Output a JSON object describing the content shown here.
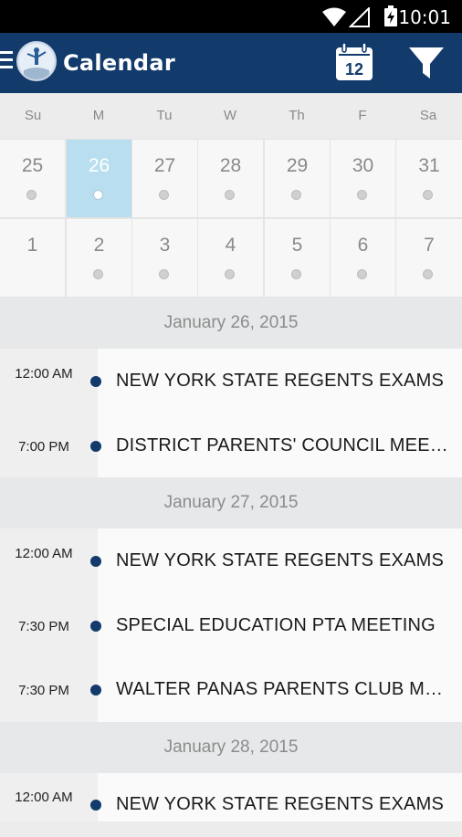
{
  "status_bar": {
    "time": "10:01",
    "battery_level": 0.6
  },
  "app_bar": {
    "title": "Calendar",
    "today_day": "12"
  },
  "calendar": {
    "weekdays": [
      "Su",
      "M",
      "Tu",
      "W",
      "Th",
      "F",
      "Sa"
    ],
    "weeks": [
      [
        "25",
        "26",
        "27",
        "28",
        "29",
        "30",
        "31"
      ],
      [
        "1",
        "2",
        "3",
        "4",
        "5",
        "6",
        "7"
      ]
    ],
    "selected_day": "26"
  },
  "agenda": [
    {
      "date": "January 26, 2015",
      "events": [
        {
          "time": "12:00 AM",
          "title": "NEW YORK STATE REGENTS EXAMS"
        },
        {
          "time": "7:00 PM",
          "title": "DISTRICT PARENTS' COUNCIL MEETING"
        }
      ]
    },
    {
      "date": "January 27, 2015",
      "events": [
        {
          "time": "12:00 AM",
          "title": "NEW YORK STATE REGENTS EXAMS"
        },
        {
          "time": "7:30 PM",
          "title": "SPECIAL EDUCATION PTA MEETING"
        },
        {
          "time": "7:30 PM",
          "title": "WALTER PANAS PARENTS CLUB MEETING"
        }
      ]
    },
    {
      "date": "January 28, 2015",
      "events": [
        {
          "time": "12:00 AM",
          "title": "NEW YORK STATE REGENTS EXAMS"
        }
      ]
    }
  ],
  "colors": {
    "app_bar": "#123a6b",
    "selected_day": "#b9def0",
    "event_bullet": "#123a6b"
  },
  "icons": [
    "wifi-icon",
    "signal-icon",
    "battery-charging-icon",
    "menu-icon",
    "app-logo",
    "calendar-today-icon",
    "filter-icon"
  ]
}
